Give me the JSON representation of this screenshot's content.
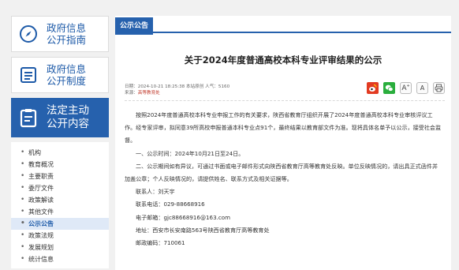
{
  "sidebar": {
    "tiles": [
      {
        "label_line1": "政府信息",
        "label_line2": "公开指南",
        "icon": "compass-icon"
      },
      {
        "label_line1": "政府信息",
        "label_line2": "公开制度",
        "icon": "document-list-icon"
      },
      {
        "label_line1": "法定主动",
        "label_line2": "公开内容",
        "icon": "clipboard-icon"
      }
    ],
    "items": [
      "机构",
      "教育概况",
      "主要职责",
      "委厅文件",
      "政策解读",
      "其他文件",
      "公示公告",
      "政策法规",
      "发展规划",
      "统计信息"
    ],
    "current_item": "公示公告"
  },
  "section": {
    "tag": "公示公告"
  },
  "article": {
    "title": "关于2024年度普通高校本科专业评审结果的公示",
    "meta_line1": "日期：2024-10-21 18:25:38  本站原创  人气：5160",
    "meta_source_label": "来源：",
    "meta_source": "高等教育处",
    "font_large": "A",
    "font_small": "A",
    "paragraphs": [
      "按照2024年度普通高校本科专业申报工作的有关要求，陕西省教育厅组织开展了2024年度普通高校本科专业审核评议工作。经专家评审，拟同意39所高校申报普通本科专业点91个，最终结果以教育部文件为准。现将具体名单予以公示，接受社会监督。",
      "一、公示时间：2024年10月21日至24日。",
      "二、公示期间如有异议，可通过书面或电子邮件形式向陕西省教育厅高等教育处反映。单位反映情况的，请出具正式函件并加盖公章；个人反映情况的，请提供姓名、联系方式及相关证据等。",
      "联系人：刘天宇",
      "联系电话：029-88668916",
      "电子邮箱：gjc88668916@163.com",
      "地址：西安市长安南路563号陕西省教育厅高等教育处",
      "邮政编码：710061"
    ]
  },
  "colors": {
    "accent": "#2661ad",
    "active_item_bg": "#dfe9f7",
    "source_red": "#c0392b"
  }
}
